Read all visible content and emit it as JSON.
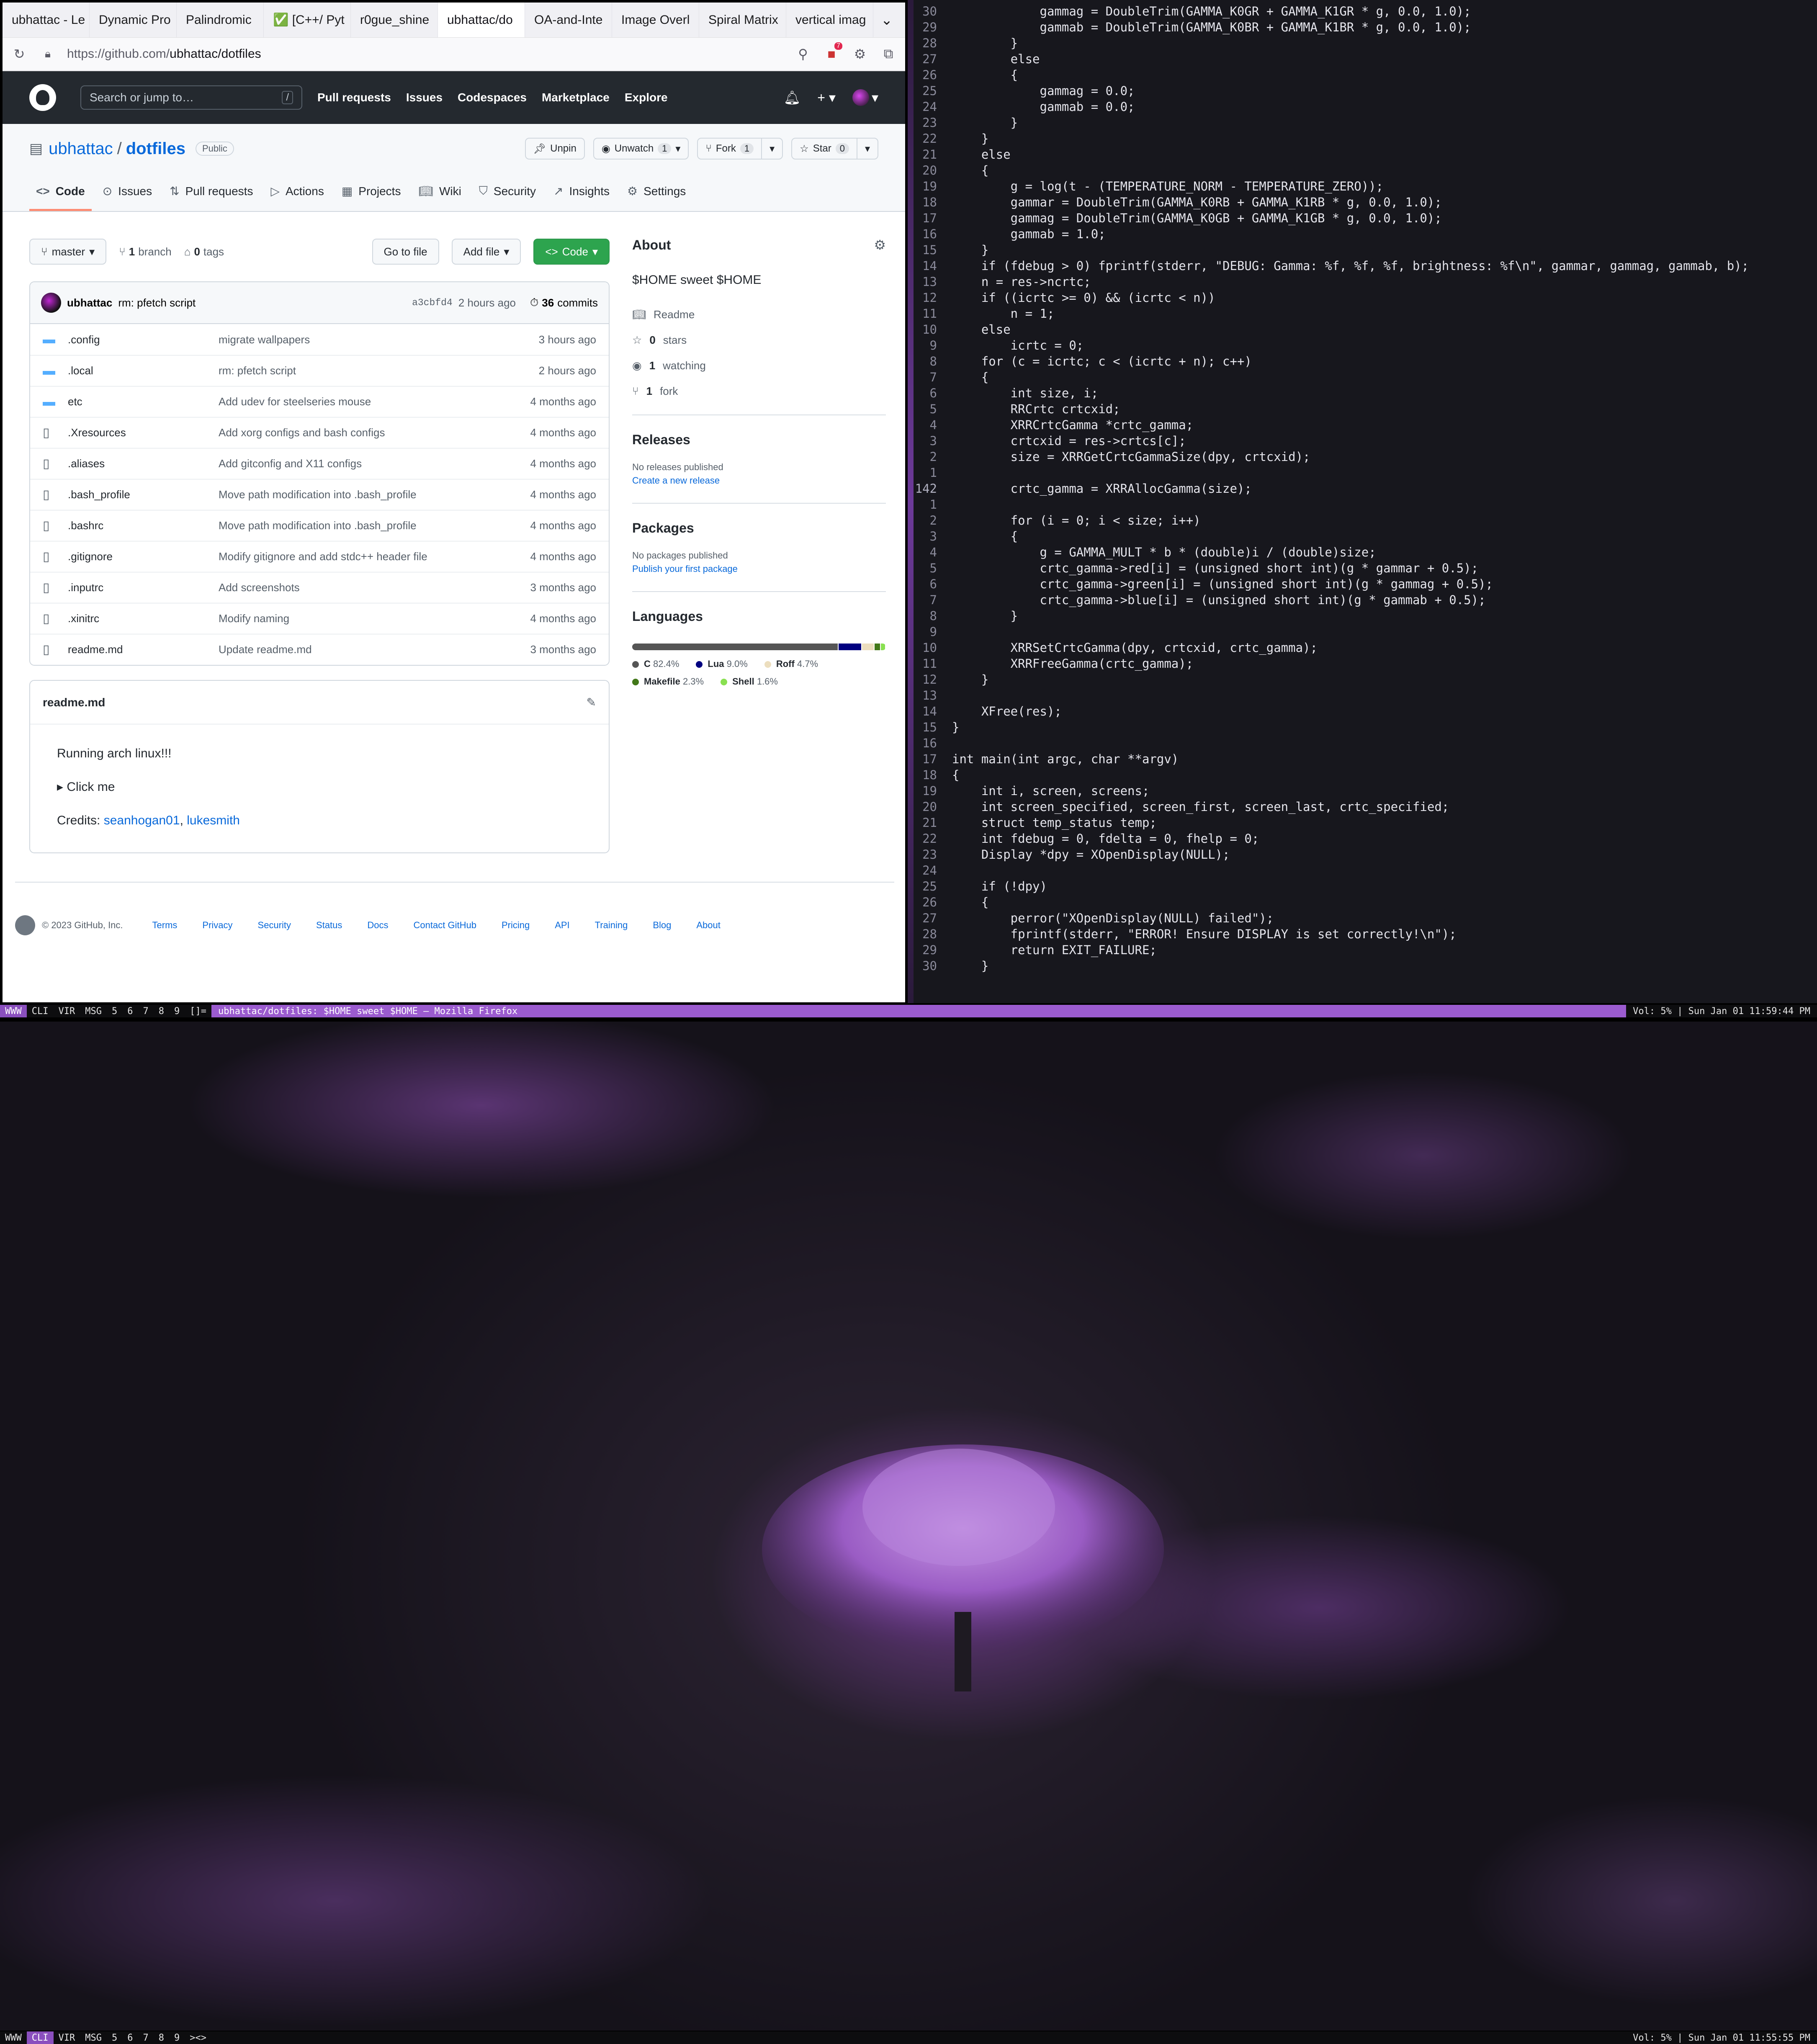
{
  "browser": {
    "tabs": [
      "ubhattac - Le",
      "Dynamic Pro",
      "Palindromic",
      "✅ [C++/ Pyt",
      "r0gue_shine",
      "ubhattac/do",
      "OA-and-Inte",
      "Image Overl",
      "Spiral Matrix",
      "vertical imag"
    ],
    "url_prefix": "https://github.com/",
    "url_path": "ubhattac/dotfiles",
    "notification_count": "7"
  },
  "github": {
    "search_placeholder": "Search or jump to…",
    "search_key": "/",
    "nav": [
      "Pull requests",
      "Issues",
      "Codespaces",
      "Marketplace",
      "Explore"
    ],
    "owner": "ubhattac",
    "repo": "dotfiles",
    "visibility": "Public",
    "actions": {
      "unpin": "Unpin",
      "unwatch": "Unwatch",
      "watch_count": "1",
      "fork": "Fork",
      "fork_count": "1",
      "star": "Star",
      "star_count": "0"
    },
    "tabs": [
      "Code",
      "Issues",
      "Pull requests",
      "Actions",
      "Projects",
      "Wiki",
      "Security",
      "Insights",
      "Settings"
    ],
    "branch": "master",
    "branches": "1",
    "branches_label": "branch",
    "tags": "0",
    "tags_label": "tags",
    "go_to_file": "Go to file",
    "add_file": "Add file",
    "code_button": "Code",
    "commit": {
      "author": "ubhattac",
      "message": "rm: pfetch script",
      "hash": "a3cbfd4",
      "ago": "2 hours ago",
      "count": "36",
      "count_label": "commits"
    },
    "files": [
      {
        "name": ".config",
        "msg": "migrate wallpapers",
        "age": "3 hours ago",
        "type": "dir"
      },
      {
        "name": ".local",
        "msg": "rm: pfetch script",
        "age": "2 hours ago",
        "type": "dir"
      },
      {
        "name": "etc",
        "msg": "Add udev for steelseries mouse",
        "age": "4 months ago",
        "type": "dir"
      },
      {
        "name": ".Xresources",
        "msg": "Add xorg configs and bash configs",
        "age": "4 months ago",
        "type": "file"
      },
      {
        "name": ".aliases",
        "msg": "Add gitconfig and X11 configs",
        "age": "4 months ago",
        "type": "file"
      },
      {
        "name": ".bash_profile",
        "msg": "Move path modification into .bash_profile",
        "age": "4 months ago",
        "type": "file"
      },
      {
        "name": ".bashrc",
        "msg": "Move path modification into .bash_profile",
        "age": "4 months ago",
        "type": "file"
      },
      {
        "name": ".gitignore",
        "msg": "Modify gitignore and add stdc++ header file",
        "age": "4 months ago",
        "type": "file"
      },
      {
        "name": ".inputrc",
        "msg": "Add screenshots",
        "age": "3 months ago",
        "type": "file"
      },
      {
        "name": ".xinitrc",
        "msg": "Modify naming",
        "age": "4 months ago",
        "type": "file"
      },
      {
        "name": "readme.md",
        "msg": "Update readme.md",
        "age": "3 months ago",
        "type": "file"
      }
    ],
    "readme": {
      "title": "readme.md",
      "line1": "Running arch linux!!!",
      "line2": "▸ Click me",
      "credits_label": "Credits:",
      "credit1": "seanhogan01",
      "credit_sep": ",",
      "credit2": "lukesmith"
    },
    "about": {
      "title": "About",
      "desc": "$HOME sweet $HOME",
      "readme": "Readme",
      "stars": "0",
      "stars_label": "stars",
      "watching": "1",
      "watching_label": "watching",
      "forks": "1",
      "forks_label": "fork"
    },
    "releases": {
      "title": "Releases",
      "none": "No releases published",
      "link": "Create a new release"
    },
    "packages": {
      "title": "Packages",
      "none": "No packages published",
      "link": "Publish your first package"
    },
    "languages": {
      "title": "Languages",
      "items": [
        {
          "name": "C",
          "pct": "82.4%",
          "value": 82.4,
          "color": "#555555"
        },
        {
          "name": "Lua",
          "pct": "9.0%",
          "value": 9.0,
          "color": "#000080"
        },
        {
          "name": "Roff",
          "pct": "4.7%",
          "value": 4.7,
          "color": "#ecdebe"
        },
        {
          "name": "Makefile",
          "pct": "2.3%",
          "value": 2.3,
          "color": "#427819"
        },
        {
          "name": "Shell",
          "pct": "1.6%",
          "value": 1.6,
          "color": "#89e051"
        }
      ]
    },
    "footer": {
      "copy": "© 2023 GitHub, Inc.",
      "links": [
        "Terms",
        "Privacy",
        "Security",
        "Status",
        "Docs",
        "Contact GitHub",
        "Pricing",
        "API",
        "Training",
        "Blog",
        "About"
      ]
    }
  },
  "editor": {
    "lines": [
      {
        "n": "30",
        "t": "            gammag = DoubleTrim(GAMMA_K0GR + GAMMA_K1GR * g, 0.0, 1.0);"
      },
      {
        "n": "29",
        "t": "            gammab = DoubleTrim(GAMMA_K0BR + GAMMA_K1BR * g, 0.0, 1.0);"
      },
      {
        "n": "28",
        "t": "        }"
      },
      {
        "n": "27",
        "t": "        else"
      },
      {
        "n": "26",
        "t": "        {"
      },
      {
        "n": "25",
        "t": "            gammag = 0.0;"
      },
      {
        "n": "24",
        "t": "            gammab = 0.0;"
      },
      {
        "n": "23",
        "t": "        }"
      },
      {
        "n": "22",
        "t": "    }"
      },
      {
        "n": "21",
        "t": "    else"
      },
      {
        "n": "20",
        "t": "    {"
      },
      {
        "n": "19",
        "t": "        g = log(t - (TEMPERATURE_NORM - TEMPERATURE_ZERO));"
      },
      {
        "n": "18",
        "t": "        gammar = DoubleTrim(GAMMA_K0RB + GAMMA_K1RB * g, 0.0, 1.0);"
      },
      {
        "n": "17",
        "t": "        gammag = DoubleTrim(GAMMA_K0GB + GAMMA_K1GB * g, 0.0, 1.0);"
      },
      {
        "n": "16",
        "t": "        gammab = 1.0;"
      },
      {
        "n": "15",
        "t": "    }"
      },
      {
        "n": "14",
        "t": "    if (fdebug > 0) fprintf(stderr, \"DEBUG: Gamma: %f, %f, %f, brightness: %f\\n\", gammar, gammag, gammab, b);"
      },
      {
        "n": "13",
        "t": "    n = res->ncrtc;"
      },
      {
        "n": "12",
        "t": "    if ((icrtc >= 0) && (icrtc < n))"
      },
      {
        "n": "11",
        "t": "        n = 1;"
      },
      {
        "n": "10",
        "t": "    else"
      },
      {
        "n": "9",
        "t": "        icrtc = 0;"
      },
      {
        "n": "8",
        "t": "    for (c = icrtc; c < (icrtc + n); c++)"
      },
      {
        "n": "7",
        "t": "    {"
      },
      {
        "n": "6",
        "t": "        int size, i;"
      },
      {
        "n": "5",
        "t": "        RRCrtc crtcxid;"
      },
      {
        "n": "4",
        "t": "        XRRCrtcGamma *crtc_gamma;"
      },
      {
        "n": "3",
        "t": "        crtcxid = res->crtcs[c];"
      },
      {
        "n": "2",
        "t": "        size = XRRGetCrtcGammaSize(dpy, crtcxid);"
      },
      {
        "n": "1",
        "t": ""
      },
      {
        "n": "142",
        "t": "        crtc_gamma = XRRAllocGamma(size);",
        "cur": true
      },
      {
        "n": "1",
        "t": ""
      },
      {
        "n": "2",
        "t": "        for (i = 0; i < size; i++)"
      },
      {
        "n": "3",
        "t": "        {"
      },
      {
        "n": "4",
        "t": "            g = GAMMA_MULT * b * (double)i / (double)size;"
      },
      {
        "n": "5",
        "t": "            crtc_gamma->red[i] = (unsigned short int)(g * gammar + 0.5);"
      },
      {
        "n": "6",
        "t": "            crtc_gamma->green[i] = (unsigned short int)(g * gammag + 0.5);"
      },
      {
        "n": "7",
        "t": "            crtc_gamma->blue[i] = (unsigned short int)(g * gammab + 0.5);"
      },
      {
        "n": "8",
        "t": "        }"
      },
      {
        "n": "9",
        "t": ""
      },
      {
        "n": "10",
        "t": "        XRRSetCrtcGamma(dpy, crtcxid, crtc_gamma);"
      },
      {
        "n": "11",
        "t": "        XRRFreeGamma(crtc_gamma);"
      },
      {
        "n": "12",
        "t": "    }"
      },
      {
        "n": "13",
        "t": ""
      },
      {
        "n": "14",
        "t": "    XFree(res);"
      },
      {
        "n": "15",
        "t": "}"
      },
      {
        "n": "16",
        "t": ""
      },
      {
        "n": "17",
        "t": "int main(int argc, char **argv)"
      },
      {
        "n": "18",
        "t": "{"
      },
      {
        "n": "19",
        "t": "    int i, screen, screens;"
      },
      {
        "n": "20",
        "t": "    int screen_specified, screen_first, screen_last, crtc_specified;"
      },
      {
        "n": "21",
        "t": "    struct temp_status temp;"
      },
      {
        "n": "22",
        "t": "    int fdebug = 0, fdelta = 0, fhelp = 0;"
      },
      {
        "n": "23",
        "t": "    Display *dpy = XOpenDisplay(NULL);"
      },
      {
        "n": "24",
        "t": ""
      },
      {
        "n": "25",
        "t": "    if (!dpy)"
      },
      {
        "n": "26",
        "t": "    {"
      },
      {
        "n": "27",
        "t": "        perror(\"XOpenDisplay(NULL) failed\");"
      },
      {
        "n": "28",
        "t": "        fprintf(stderr, \"ERROR! Ensure DISPLAY is set correctly!\\n\");"
      },
      {
        "n": "29",
        "t": "        return EXIT_FAILURE;"
      },
      {
        "n": "30",
        "t": "    }"
      }
    ]
  },
  "bar_top": {
    "tags": [
      "WWW",
      "CLI",
      "VIR",
      "MSG",
      "5",
      "6",
      "7",
      "8",
      "9"
    ],
    "layout": "[]=",
    "title": "ubhattac/dotfiles: $HOME sweet $HOME — Mozilla Firefox",
    "status": "Vol: 5% | Sun Jan 01 11:59:44 PM"
  },
  "bar_bottom": {
    "tags": [
      "WWW",
      "CLI",
      "VIR",
      "MSG",
      "5",
      "6",
      "7",
      "8",
      "9"
    ],
    "layout": "><>",
    "status": "Vol: 5% | Sun Jan 01 11:55:55 PM"
  }
}
